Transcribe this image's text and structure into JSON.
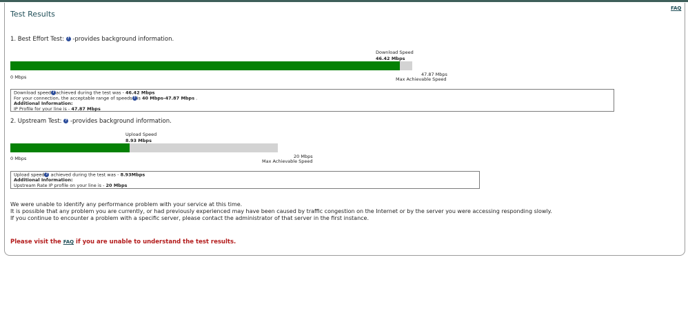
{
  "page": {
    "title": "Test Results",
    "faq_link": "FAQ"
  },
  "best_effort": {
    "heading_prefix": "1. Best Effort Test:",
    "heading_suffix": "-provides background information.",
    "speed_label": "Download Speed",
    "speed_value": "46.42 Mbps",
    "min_label": "0 Mbps",
    "max_value": "47.87 Mbps",
    "max_label": "Max Achievable Speed",
    "fill_fraction": 0.9697,
    "info": {
      "line1_prefix": "Download speed",
      "line1_mid": "achieved during the test was - ",
      "line1_value": "46.42 Mbps",
      "line2_prefix": "For your connection, the acceptable range of speeds",
      "line2_mid": "is ",
      "line2_value": "40 Mbps-47.87 Mbps",
      "line2_suffix": " .",
      "line3": "Additional Information:",
      "line4_prefix": "IP Profile for your line is - ",
      "line4_value": "47.87 Mbps"
    }
  },
  "upstream": {
    "heading_prefix": "2. Upstream Test:",
    "heading_suffix": "-provides background information.",
    "speed_label": "Upload Speed",
    "speed_value": "8.93 Mbps",
    "min_label": "0 Mbps",
    "max_value": "20 Mbps",
    "max_label": "Max Achievable Speed",
    "fill_fraction": 0.4465,
    "info": {
      "line1_prefix": "Upload speed",
      "line1_mid": " achieved during the test was - ",
      "line1_value": "8.93Mbps",
      "line2": "Additional Information:",
      "line3_prefix": "Upstream Rate IP profile on your line is - ",
      "line3_value": "20 Mbps"
    }
  },
  "messages": {
    "line1": "We were unable to identify any performance problem with your service at this time.",
    "line2": "It is possible that any problem you are currently, or had previously experienced may have been caused by traffic congestion on the Internet or by the server you were accessing responding slowly.",
    "line3": "If you continue to encounter a problem with a specific server, please contact the administrator of that server in the first instance."
  },
  "footer": {
    "visit_prefix": "Please visit the ",
    "visit_link": "FAQ",
    "visit_suffix": " if you are unable to understand the test results."
  },
  "colors": {
    "bar_fill": "#058105",
    "bar_track": "#d3d3d3",
    "title": "#1f4e57",
    "warning": "#b31b1b"
  }
}
